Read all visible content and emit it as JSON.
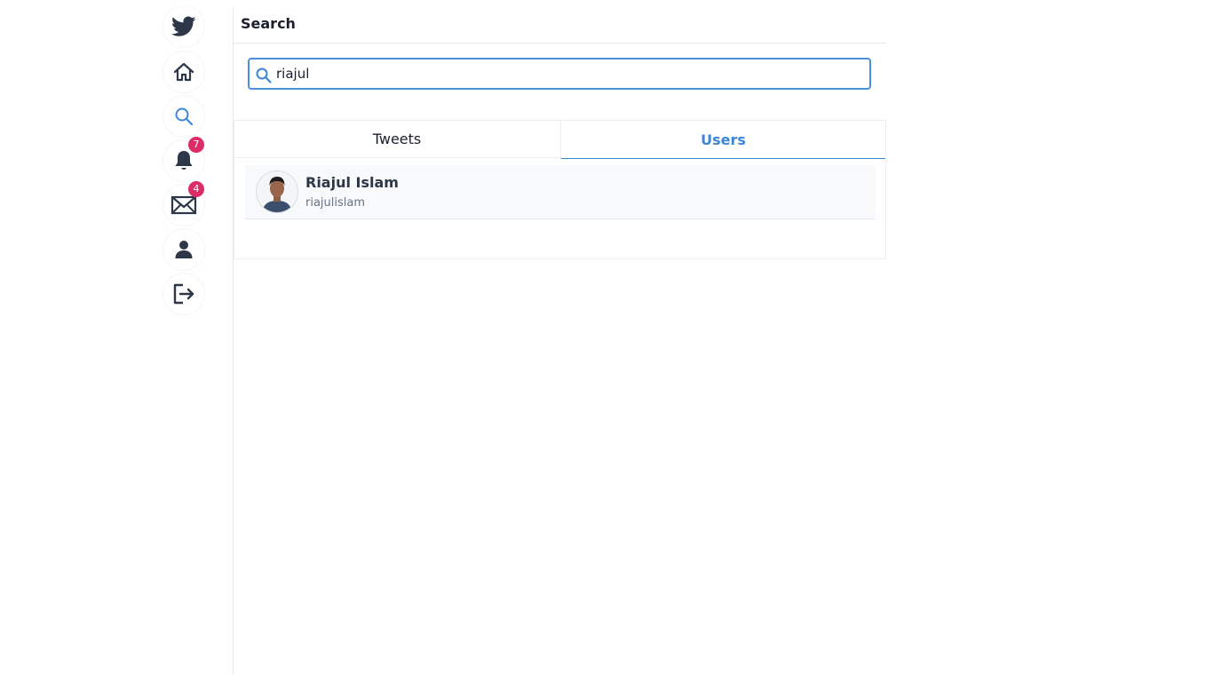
{
  "sidebar": {
    "items": [
      {
        "name": "logo",
        "icon": "twitter-bird-icon"
      },
      {
        "name": "home",
        "icon": "home-icon"
      },
      {
        "name": "search",
        "icon": "search-icon",
        "active": true
      },
      {
        "name": "notifications",
        "icon": "bell-icon",
        "badge": "7"
      },
      {
        "name": "messages",
        "icon": "envelope-icon",
        "badge": "4"
      },
      {
        "name": "profile",
        "icon": "user-icon"
      },
      {
        "name": "logout",
        "icon": "logout-icon"
      }
    ]
  },
  "header": {
    "title": "Search"
  },
  "search": {
    "value": "riajul"
  },
  "tabs": [
    {
      "label": "Tweets",
      "active": false
    },
    {
      "label": "Users",
      "active": true
    }
  ],
  "results": [
    {
      "name": "Riajul Islam",
      "handle": "riajulislam"
    }
  ],
  "colors": {
    "accent": "#3b86d6",
    "badge": "#dc2c68",
    "icon": "#2d3748"
  }
}
